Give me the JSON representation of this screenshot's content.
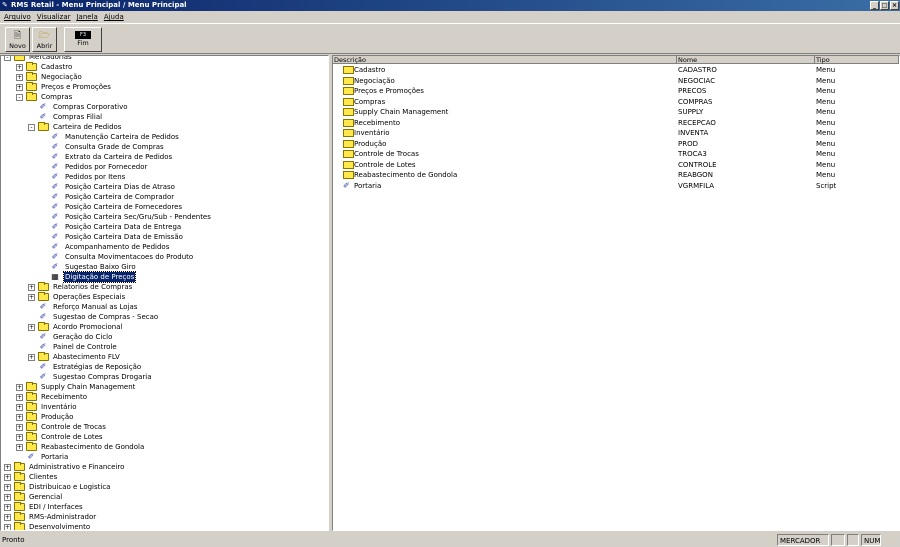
{
  "window": {
    "title": "RMS Retail - Menu Principal / Menu Principal",
    "controls": [
      "_",
      "□",
      "×"
    ]
  },
  "menu": [
    "Arquivo",
    "Visualizar",
    "Janela",
    "Ajuda"
  ],
  "toolbar": {
    "novo": "Novo",
    "abrir": "Abrir",
    "fim": "Fim",
    "fim_key": "F3"
  },
  "tree": [
    {
      "label": "Mercadorias",
      "level": 0,
      "icon": "folder",
      "exp": "-"
    },
    {
      "label": "Cadastro",
      "level": 1,
      "icon": "folder",
      "exp": "+"
    },
    {
      "label": "Negociação",
      "level": 1,
      "icon": "folder",
      "exp": "+"
    },
    {
      "label": "Preços e Promoções",
      "level": 1,
      "icon": "folder",
      "exp": "+"
    },
    {
      "label": "Compras",
      "level": 1,
      "icon": "folder",
      "exp": "-"
    },
    {
      "label": "Compras Corporativo",
      "level": 2,
      "icon": "script"
    },
    {
      "label": "Compras Filial",
      "level": 2,
      "icon": "script"
    },
    {
      "label": "Carteira de Pedidos",
      "level": 2,
      "icon": "folder",
      "exp": "-"
    },
    {
      "label": "Manutenção Carteira de Pedidos",
      "level": 3,
      "icon": "script"
    },
    {
      "label": "Consulta Grade de Compras",
      "level": 3,
      "icon": "script"
    },
    {
      "label": "Extrato da Carteira de Pedidos",
      "level": 3,
      "icon": "script"
    },
    {
      "label": "Pedidos por Fornecedor",
      "level": 3,
      "icon": "script"
    },
    {
      "label": "Pedidos por Itens",
      "level": 3,
      "icon": "script"
    },
    {
      "label": "Posição Carteira Dias de Atraso",
      "level": 3,
      "icon": "script"
    },
    {
      "label": "Posição Carteira de Comprador",
      "level": 3,
      "icon": "script"
    },
    {
      "label": "Posição Carteira de Fornecedores",
      "level": 3,
      "icon": "script"
    },
    {
      "label": "Posição Carteira Sec/Gru/Sub - Pendentes",
      "level": 3,
      "icon": "script"
    },
    {
      "label": "Posição Carteira Data de Entrega",
      "level": 3,
      "icon": "script"
    },
    {
      "label": "Posição Carteira Data de Emissão",
      "level": 3,
      "icon": "script"
    },
    {
      "label": "Acompanhamento de Pedidos",
      "level": 3,
      "icon": "script"
    },
    {
      "label": "Consulta Movimentacoes do Produto",
      "level": 3,
      "icon": "script"
    },
    {
      "label": "Sugestao Baixo Giro",
      "level": 3,
      "icon": "script"
    },
    {
      "label": "Digitação de Preços",
      "level": 3,
      "icon": "form",
      "selected": true
    },
    {
      "label": "Relatorios de Compras",
      "level": 2,
      "icon": "folder",
      "exp": "+"
    },
    {
      "label": "Operações Especiais",
      "level": 2,
      "icon": "folder",
      "exp": "+"
    },
    {
      "label": "Reforço Manual as Lojas",
      "level": 2,
      "icon": "script"
    },
    {
      "label": "Sugestao de Compras - Secao",
      "level": 2,
      "icon": "script"
    },
    {
      "label": "Acordo Promocional",
      "level": 2,
      "icon": "folder",
      "exp": "+"
    },
    {
      "label": "Geração do Ciclo",
      "level": 2,
      "icon": "script"
    },
    {
      "label": "Painel de Controle",
      "level": 2,
      "icon": "script"
    },
    {
      "label": "Abastecimento FLV",
      "level": 2,
      "icon": "folder",
      "exp": "+"
    },
    {
      "label": "Estratégias de Reposição",
      "level": 2,
      "icon": "script"
    },
    {
      "label": "Sugestao Compras Drogaria",
      "level": 2,
      "icon": "script"
    },
    {
      "label": "Supply Chain Management",
      "level": 1,
      "icon": "folder",
      "exp": "+"
    },
    {
      "label": "Recebimento",
      "level": 1,
      "icon": "folder",
      "exp": "+"
    },
    {
      "label": "Inventário",
      "level": 1,
      "icon": "folder",
      "exp": "+"
    },
    {
      "label": "Produção",
      "level": 1,
      "icon": "folder",
      "exp": "+"
    },
    {
      "label": "Controle de Trocas",
      "level": 1,
      "icon": "folder",
      "exp": "+"
    },
    {
      "label": "Controle de Lotes",
      "level": 1,
      "icon": "folder",
      "exp": "+"
    },
    {
      "label": "Reabastecimento de Gondola",
      "level": 1,
      "icon": "folder",
      "exp": "+"
    },
    {
      "label": "Portaria",
      "level": 1,
      "icon": "script"
    },
    {
      "label": "Administrativo e Financeiro",
      "level": 0,
      "icon": "folder",
      "exp": "+"
    },
    {
      "label": "Clientes",
      "level": 0,
      "icon": "folder",
      "exp": "+"
    },
    {
      "label": "Distribuicao e Logistica",
      "level": 0,
      "icon": "folder",
      "exp": "+"
    },
    {
      "label": "Gerencial",
      "level": 0,
      "icon": "folder",
      "exp": "+"
    },
    {
      "label": "EDI / Interfaces",
      "level": 0,
      "icon": "folder",
      "exp": "+"
    },
    {
      "label": "RMS-Administrador",
      "level": 0,
      "icon": "folder",
      "exp": "+"
    },
    {
      "label": "Desenvolvimento",
      "level": 0,
      "icon": "folder",
      "exp": "+"
    }
  ],
  "list": {
    "columns": [
      "Descrição",
      "Nome",
      "Tipo"
    ],
    "rows": [
      {
        "desc": "Cadastro",
        "nome": "CADASTRO",
        "tipo": "Menu",
        "icon": "folder"
      },
      {
        "desc": "Negociação",
        "nome": "NEGOCIAC",
        "tipo": "Menu",
        "icon": "folder"
      },
      {
        "desc": "Preços e Promoções",
        "nome": "PRECOS",
        "tipo": "Menu",
        "icon": "folder"
      },
      {
        "desc": "Compras",
        "nome": "COMPRAS",
        "tipo": "Menu",
        "icon": "folder"
      },
      {
        "desc": "Supply Chain Management",
        "nome": "SUPPLY",
        "tipo": "Menu",
        "icon": "folder"
      },
      {
        "desc": "Recebimento",
        "nome": "RECEPCAO",
        "tipo": "Menu",
        "icon": "folder"
      },
      {
        "desc": "Inventário",
        "nome": "INVENTA",
        "tipo": "Menu",
        "icon": "folder"
      },
      {
        "desc": "Produção",
        "nome": "PROD",
        "tipo": "Menu",
        "icon": "folder"
      },
      {
        "desc": "Controle de Trocas",
        "nome": "TROCA3",
        "tipo": "Menu",
        "icon": "folder"
      },
      {
        "desc": "Controle de Lotes",
        "nome": "CONTROLE",
        "tipo": "Menu",
        "icon": "folder"
      },
      {
        "desc": "Reabastecimento de Gondola",
        "nome": "REABGON",
        "tipo": "Menu",
        "icon": "folder"
      },
      {
        "desc": "Portaria",
        "nome": "VGRMFILA",
        "tipo": "Script",
        "icon": "script"
      }
    ]
  },
  "status": {
    "text": "Pronto",
    "module": "MERCADOR",
    "p1": "",
    "p2": "",
    "num": "NUM"
  }
}
